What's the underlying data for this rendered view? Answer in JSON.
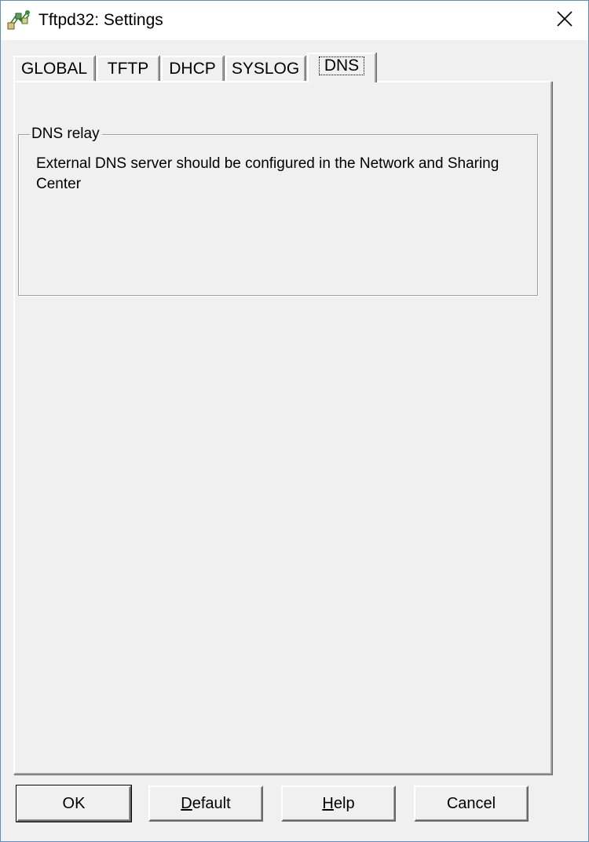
{
  "window": {
    "title": "Tftpd32: Settings",
    "icon": "tftpd32-app-icon",
    "close_icon": "close-icon"
  },
  "tabs": [
    {
      "label": "GLOBAL",
      "active": false
    },
    {
      "label": "TFTP",
      "active": false
    },
    {
      "label": "DHCP",
      "active": false
    },
    {
      "label": "SYSLOG",
      "active": false
    },
    {
      "label": "DNS",
      "active": true
    }
  ],
  "dns": {
    "group_title": "DNS relay",
    "message": "External DNS server should be configured in the Network and Sharing Center"
  },
  "buttons": {
    "ok": "OK",
    "default_first": "D",
    "default_rest": "efault",
    "help_first": "H",
    "help_rest": "elp",
    "cancel": "Cancel"
  },
  "colors": {
    "window_bg": "#f0f0f0",
    "titlebar_bg": "#ffffff",
    "window_border": "#5b8fc7"
  }
}
